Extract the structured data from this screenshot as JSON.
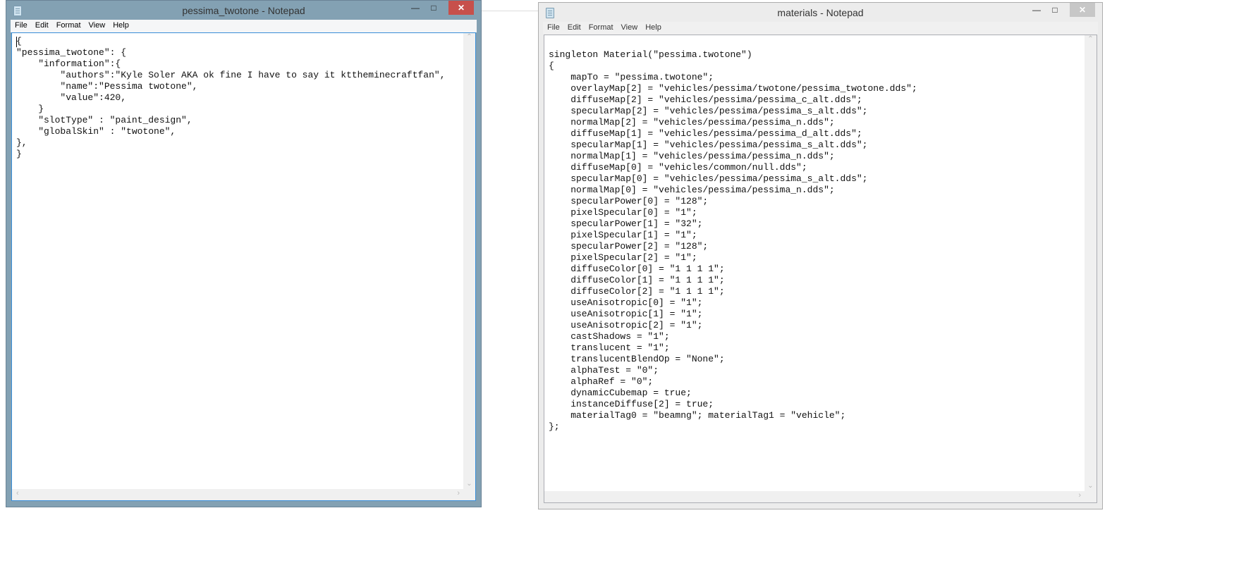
{
  "left_window": {
    "title": "pessima_twotone - Notepad",
    "menu": [
      "File",
      "Edit",
      "Format",
      "View",
      "Help"
    ],
    "lines": [
      "{",
      "\"pessima_twotone\": {",
      "    \"information\":{",
      "        \"authors\":\"Kyle Soler AKA ok fine I have to say it kttheminecraftfan\",",
      "        \"name\":\"Pessima twotone\",",
      "        \"value\":420,",
      "    }",
      "    \"slotType\" : \"paint_design\",",
      "    \"globalSkin\" : \"twotone\",",
      "},",
      "}"
    ]
  },
  "right_window": {
    "title": "materials - Notepad",
    "menu": [
      "File",
      "Edit",
      "Format",
      "View",
      "Help"
    ],
    "lines": [
      "",
      "singleton Material(\"pessima.twotone\")",
      "{",
      "    mapTo = \"pessima.twotone\";",
      "    overlayMap[2] = \"vehicles/pessima/twotone/pessima_twotone.dds\";",
      "    diffuseMap[2] = \"vehicles/pessima/pessima_c_alt.dds\";",
      "    specularMap[2] = \"vehicles/pessima/pessima_s_alt.dds\";",
      "    normalMap[2] = \"vehicles/pessima/pessima_n.dds\";",
      "    diffuseMap[1] = \"vehicles/pessima/pessima_d_alt.dds\";",
      "    specularMap[1] = \"vehicles/pessima/pessima_s_alt.dds\";",
      "    normalMap[1] = \"vehicles/pessima/pessima_n.dds\";",
      "    diffuseMap[0] = \"vehicles/common/null.dds\";",
      "    specularMap[0] = \"vehicles/pessima/pessima_s_alt.dds\";",
      "    normalMap[0] = \"vehicles/pessima/pessima_n.dds\";",
      "    specularPower[0] = \"128\";",
      "    pixelSpecular[0] = \"1\";",
      "    specularPower[1] = \"32\";",
      "    pixelSpecular[1] = \"1\";",
      "    specularPower[2] = \"128\";",
      "    pixelSpecular[2] = \"1\";",
      "    diffuseColor[0] = \"1 1 1 1\";",
      "    diffuseColor[1] = \"1 1 1 1\";",
      "    diffuseColor[2] = \"1 1 1 1\";",
      "    useAnisotropic[0] = \"1\";",
      "    useAnisotropic[1] = \"1\";",
      "    useAnisotropic[2] = \"1\";",
      "    castShadows = \"1\";",
      "    translucent = \"1\";",
      "    translucentBlendOp = \"None\";",
      "    alphaTest = \"0\";",
      "    alphaRef = \"0\";",
      "    dynamicCubemap = true;",
      "    instanceDiffuse[2] = true;",
      "    materialTag0 = \"beamng\"; materialTag1 = \"vehicle\";",
      "};"
    ]
  }
}
